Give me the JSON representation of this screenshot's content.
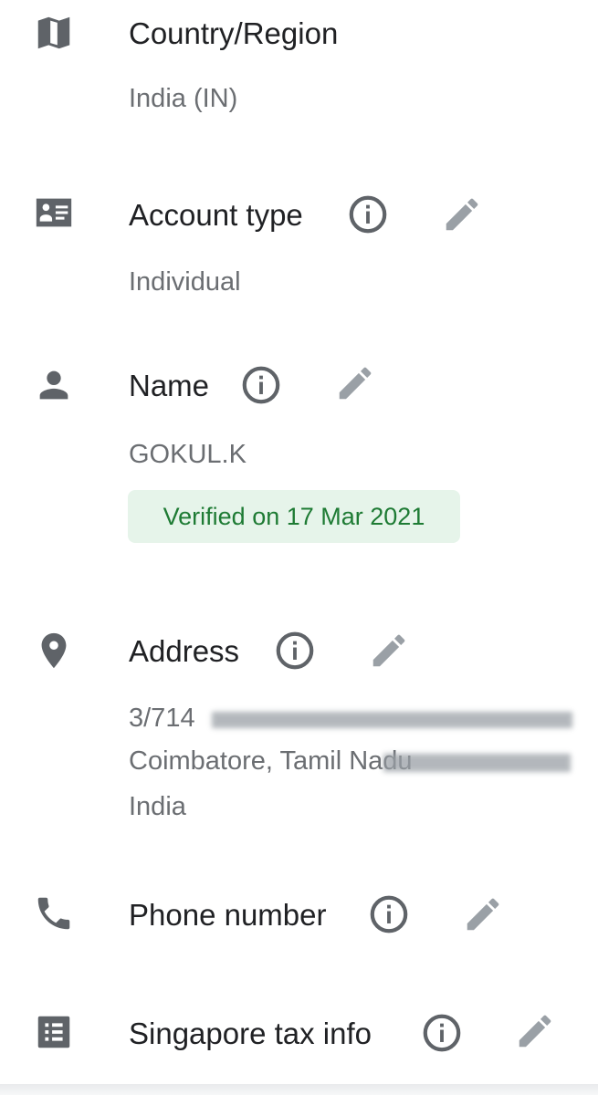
{
  "country": {
    "title": "Country/Region",
    "value": "India (IN)"
  },
  "account_type": {
    "title": "Account type",
    "value": "Individual"
  },
  "name": {
    "title": "Name",
    "value": "GOKUL.K",
    "verified_badge": "Verified on 17 Mar 2021"
  },
  "address": {
    "title": "Address",
    "line1": "3/714",
    "line2": "Coimbatore, Tamil Nadu",
    "line3": "India"
  },
  "phone": {
    "title": "Phone number"
  },
  "tax": {
    "title": "Singapore tax info"
  },
  "icons": {
    "country": "map-icon",
    "account_type": "id-card-icon",
    "name": "person-icon",
    "address": "location-pin-icon",
    "phone": "phone-icon",
    "tax": "list-icon",
    "info": "info-icon",
    "edit": "pencil-icon"
  },
  "colors": {
    "icon": "#5f6368",
    "edit_icon": "#9aa0a6",
    "badge_bg": "#e6f4ea",
    "badge_text": "#1e7b34"
  }
}
